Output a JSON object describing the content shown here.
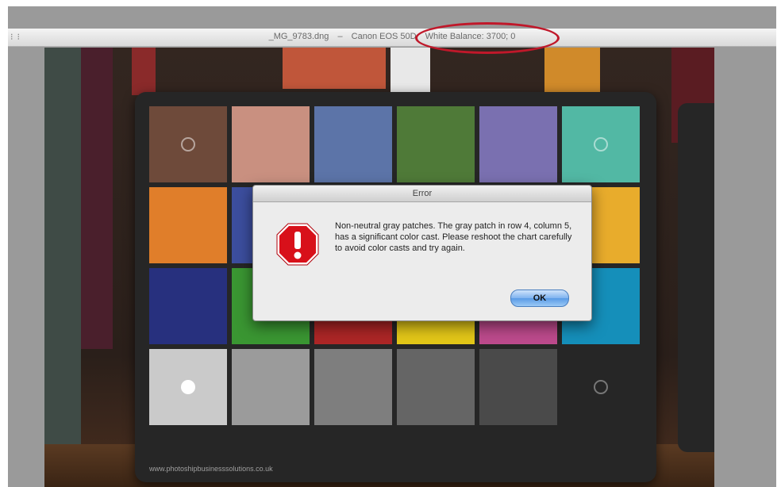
{
  "window": {
    "controls": "⁝ ⁝",
    "filename": "_MG_9783.dng",
    "separator": "–",
    "camera": "Canon EOS 50D",
    "white_balance": "White Balance: 3700; 0"
  },
  "colors": {
    "highlight_ring": "#c0182a",
    "ok_button": "#5a9be6",
    "error_icon": "#d8101a"
  },
  "chart_card": {
    "url": "www.photoshipbusinesssolutions.co.uk",
    "rows": [
      [
        "#6e4a3a",
        "#c99080",
        "#5c74a8",
        "#4f7a38",
        "#7a70b0",
        "#52b8a4"
      ],
      [
        "#e07e2a",
        "#3c4e9e",
        "#c44452",
        "#4a2c62",
        "#a2bb2e",
        "#e8ac2c"
      ],
      [
        "#27307e",
        "#3a9632",
        "#ac2626",
        "#e2c618",
        "#bc4a8c",
        "#158fba"
      ],
      [
        "#cacaca",
        "#9b9b9b",
        "#7e7e7e",
        "#656565",
        "#4a4a4a",
        "#262626"
      ]
    ]
  },
  "dialog": {
    "title": "Error",
    "icon": "stop-icon",
    "message": "Non-neutral gray patches. The gray patch in row 4, column 5, has a significant color cast. Please reshoot the chart carefully to avoid color casts and try again.",
    "ok_label": "OK"
  }
}
